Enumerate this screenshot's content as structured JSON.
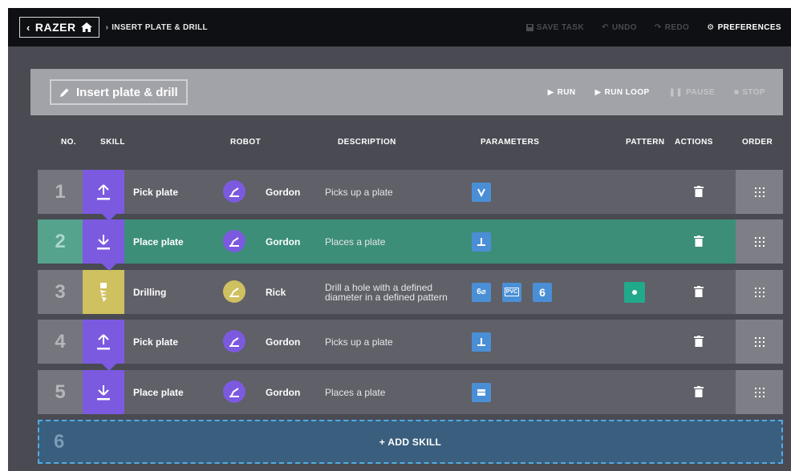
{
  "app": {
    "brand": "RAZER",
    "breadcrumb": "INSERT PLATE & DRILL"
  },
  "top_actions": {
    "save_task": "SAVE TASK",
    "undo": "UNDO",
    "redo": "REDO",
    "preferences": "PREFERENCES"
  },
  "task": {
    "name": "Insert plate & drill"
  },
  "run_actions": {
    "run": "RUN",
    "run_loop": "RUN LOOP",
    "pause": "PAUSE",
    "stop": "STOP"
  },
  "columns": {
    "no": "NO.",
    "skill": "SKILL",
    "robot": "ROBOT",
    "description": "DESCRIPTION",
    "parameters": "PARAMETERS",
    "pattern": "PATTERN",
    "actions": "ACTIONS",
    "order": "ORDER"
  },
  "rows": [
    {
      "no": "1",
      "skill": "Pick plate",
      "robot": "Gordon",
      "description": "Picks up a plate",
      "skill_icon": "pick-icon",
      "color": "#7b5ae0"
    },
    {
      "no": "2",
      "skill": "Place plate",
      "robot": "Gordon",
      "description": "Places a plate",
      "skill_icon": "place-icon",
      "color": "#7b5ae0",
      "selected": true
    },
    {
      "no": "3",
      "skill": "Drilling",
      "robot": "Rick",
      "description": "Drill a hole with a defined diameter in a defined pattern",
      "skill_icon": "drill-icon",
      "color": "#cfc060",
      "params": {
        "diameter": "6⌀",
        "material": "PVC",
        "count": "6"
      }
    },
    {
      "no": "4",
      "skill": "Pick plate",
      "robot": "Gordon",
      "description": "Picks up a plate",
      "skill_icon": "pick-icon",
      "color": "#7b5ae0"
    },
    {
      "no": "5",
      "skill": "Place plate",
      "robot": "Gordon",
      "description": "Places a plate",
      "skill_icon": "place-icon",
      "color": "#7b5ae0"
    }
  ],
  "add_row": {
    "no": "6",
    "label": "+ ADD SKILL"
  },
  "colors": {
    "accent_purple": "#7b5ae0",
    "accent_yellow": "#cfc060",
    "selected_row": "#3c8e78",
    "param_blue": "#4a8fd6",
    "pattern_green": "#21a98c",
    "add_border": "#56a9e4"
  }
}
